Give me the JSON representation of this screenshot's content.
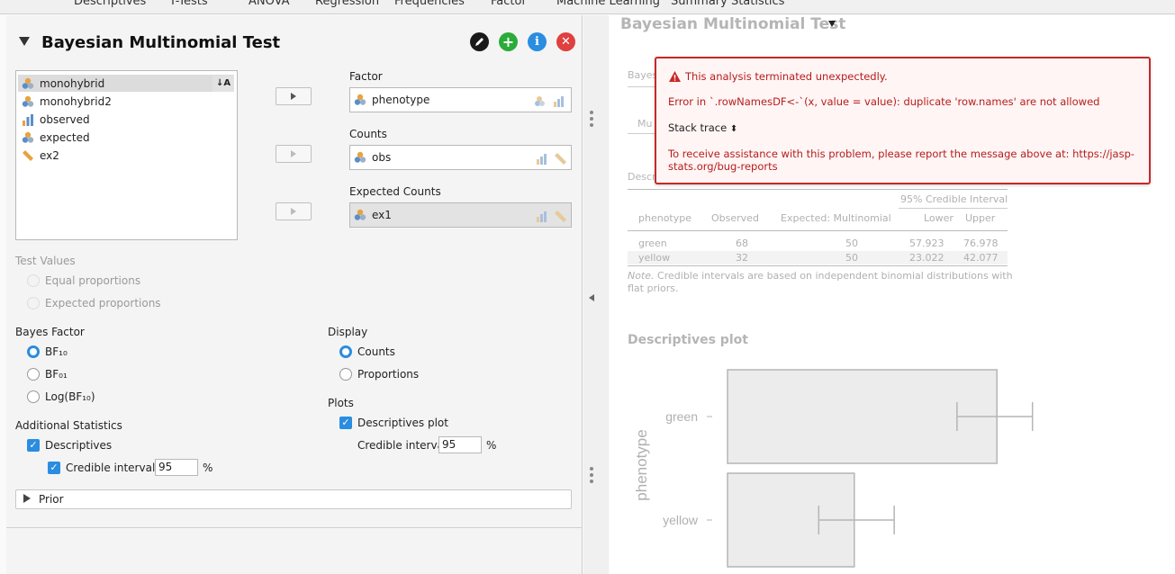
{
  "menu": [
    "Descriptives",
    "T-Tests",
    "ANOVA",
    "Regression",
    "Frequencies",
    "Factor",
    "Machine Learning",
    "Summary Statistics"
  ],
  "analysis": {
    "title": "Bayesian Multinomial Test",
    "colors": {
      "edit": "#1a1a1a",
      "add": "#2bab3a",
      "info": "#2a8de0",
      "close": "#e04040"
    }
  },
  "variables": [
    {
      "name": "monohybrid",
      "icon": "nominal-icon",
      "selected": true
    },
    {
      "name": "monohybrid2",
      "icon": "nominal-icon",
      "selected": false
    },
    {
      "name": "observed",
      "icon": "ordinal-icon",
      "selected": false
    },
    {
      "name": "expected",
      "icon": "nominal-icon",
      "selected": false
    },
    {
      "name": "ex2",
      "icon": "scale-icon",
      "selected": false
    }
  ],
  "assign": {
    "factor_label": "Factor",
    "factor_value": "phenotype",
    "counts_label": "Counts",
    "counts_value": "obs",
    "expected_label": "Expected Counts",
    "expected_value": "ex1"
  },
  "test_values": {
    "label": "Test Values",
    "options": [
      "Equal proportions",
      "Expected proportions"
    ]
  },
  "bayes_factor": {
    "label": "Bayes Factor",
    "options": [
      "BF₁₀",
      "BF₀₁",
      "Log(BF₁₀)"
    ],
    "selected": "BF₁₀"
  },
  "additional": {
    "label": "Additional Statistics",
    "descriptives": "Descriptives",
    "credible_interval": "Credible interval",
    "ci_value": "95",
    "percent": "%"
  },
  "display": {
    "label": "Display",
    "options": [
      "Counts",
      "Proportions"
    ],
    "selected": "Counts"
  },
  "plots": {
    "label": "Plots",
    "descriptives_plot": "Descriptives plot",
    "credible_interval": "Credible interval",
    "ci_value": "95",
    "percent": "%"
  },
  "prior": {
    "label": "Prior"
  },
  "results": {
    "title": "Bayesian Multinomial Test",
    "bayes_partial": "Bayes",
    "mu_partial": "Mu",
    "desc_partial": "Descr",
    "error": {
      "title": "This analysis terminated unexpectedly.",
      "message": "Error in `.rowNamesDF<-`(x, value = value): duplicate 'row.names' are not allowed",
      "stack_trace": "Stack trace",
      "help_line1": "To receive assistance with this problem, please report the message above at: https://jasp-",
      "help_line2": "stats.org/bug-reports"
    },
    "table": {
      "group_header": "95% Credible Interval",
      "headers": [
        "phenotype",
        "Observed",
        "Expected: Multinomial",
        "Lower",
        "Upper"
      ],
      "rows": [
        [
          "green",
          "68",
          "50",
          "57.923",
          "76.978"
        ],
        [
          "yellow",
          "32",
          "50",
          "23.022",
          "42.077"
        ]
      ],
      "note_label": "Note.",
      "note_line1": "Credible intervals are based on independent binomial distributions with",
      "note_line2": "flat priors."
    },
    "plot_title": "Descriptives plot"
  },
  "chart_data": {
    "type": "bar",
    "orientation": "horizontal",
    "ylabel": "phenotype",
    "categories": [
      "green",
      "yellow"
    ],
    "values": [
      68,
      32
    ],
    "ci_lower": [
      57.923,
      23.022
    ],
    "ci_upper": [
      76.978,
      42.077
    ]
  }
}
